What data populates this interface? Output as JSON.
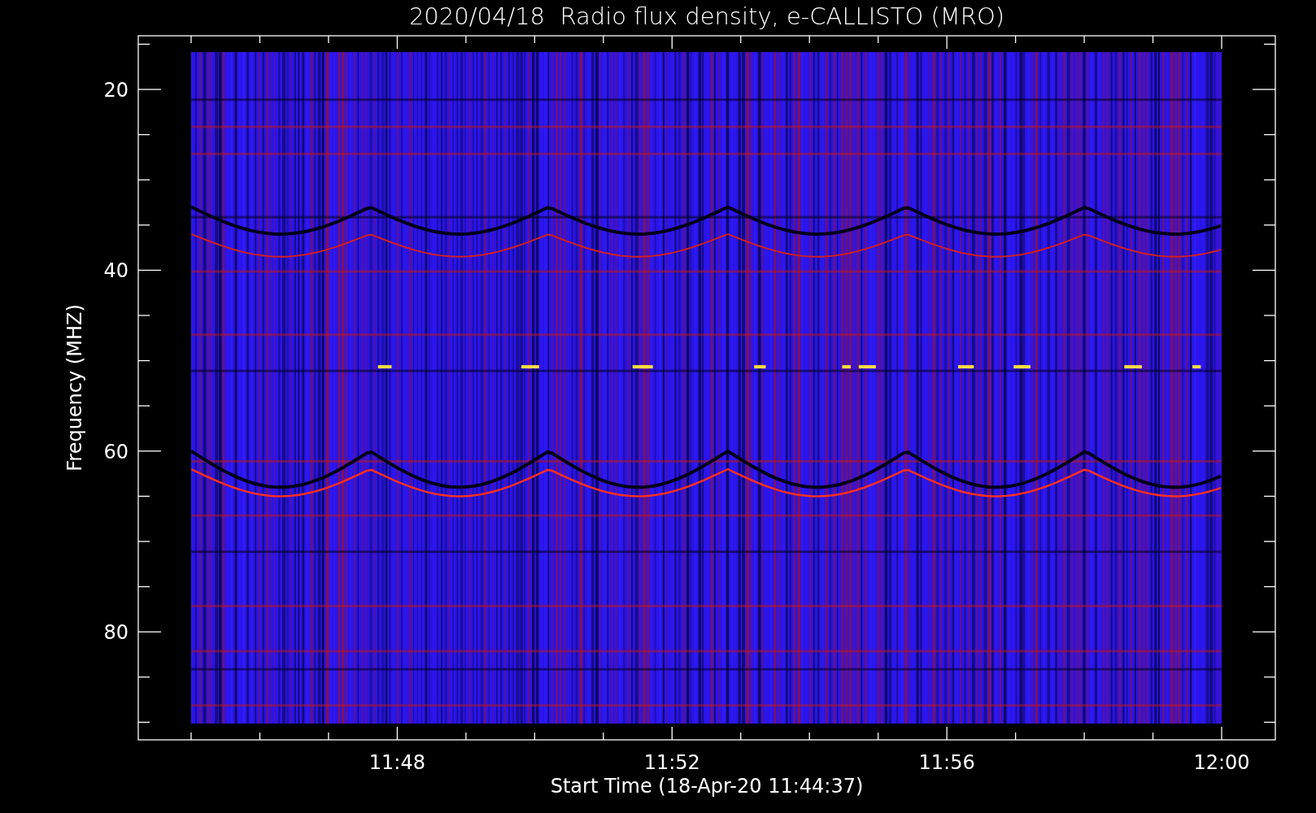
{
  "title": "2020/04/18  Radio flux density, e-CALLISTO (MRO)",
  "y_axis": {
    "label": "Frequency (MHZ)",
    "ticks": [
      "20",
      "40",
      "60",
      "80"
    ]
  },
  "x_axis": {
    "label": "Start Time (18-Apr-20 11:44:37)",
    "ticks": [
      "11:48",
      "11:52",
      "11:56",
      "12:00"
    ]
  }
}
